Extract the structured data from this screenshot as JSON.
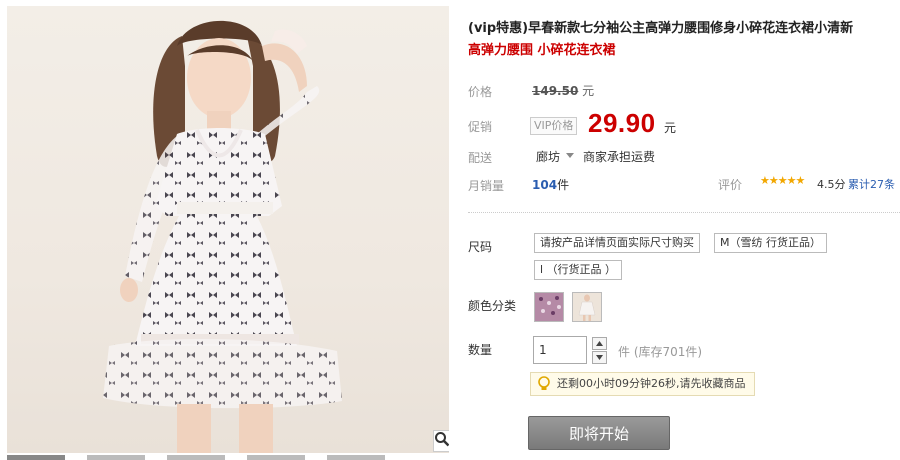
{
  "product": {
    "title": "(vip特惠)早春新款七分袖公主高弹力腰围修身小碎花连衣裙小清新",
    "subtitle": "高弹力腰围 小碎花连衣裙"
  },
  "price": {
    "label": "价格",
    "original": "149.50",
    "unit": "元"
  },
  "promo": {
    "label": "促销",
    "tag": "VIP价格",
    "price": "29.90",
    "unit": "元"
  },
  "shipping": {
    "label": "配送",
    "city": "廊坊",
    "note": "商家承担运费"
  },
  "sales": {
    "label": "月销量",
    "count": "104",
    "unit": "件"
  },
  "rating": {
    "label": "评价",
    "stars": "★★★★★",
    "score": "4.5分",
    "total": "累计27条",
    "value": 4.5
  },
  "size": {
    "label": "尺码",
    "options": [
      "请按产品详情页面实际尺寸购买",
      "M（雪纺 行货正品）",
      "l （行货正品 ）"
    ]
  },
  "color": {
    "label": "颜色分类",
    "swatch1_icon": "dress-pink-print-thumb",
    "swatch2_icon": "dress-white-model-thumb"
  },
  "quantity": {
    "label": "数量",
    "value": "1",
    "stock": "件 (库存701件)"
  },
  "notice": {
    "icon": "lightbulb-icon",
    "text": "还剩00小时09分钟26秒,请先收藏商品"
  },
  "buy_button": "即将开始",
  "colors": {
    "accent_red": "#cc0000",
    "link_blue": "#2a5db0",
    "star": "#f2a700",
    "button_gray": "#8a8a8a"
  },
  "image": {
    "zoom_icon": "magnifier-icon"
  }
}
